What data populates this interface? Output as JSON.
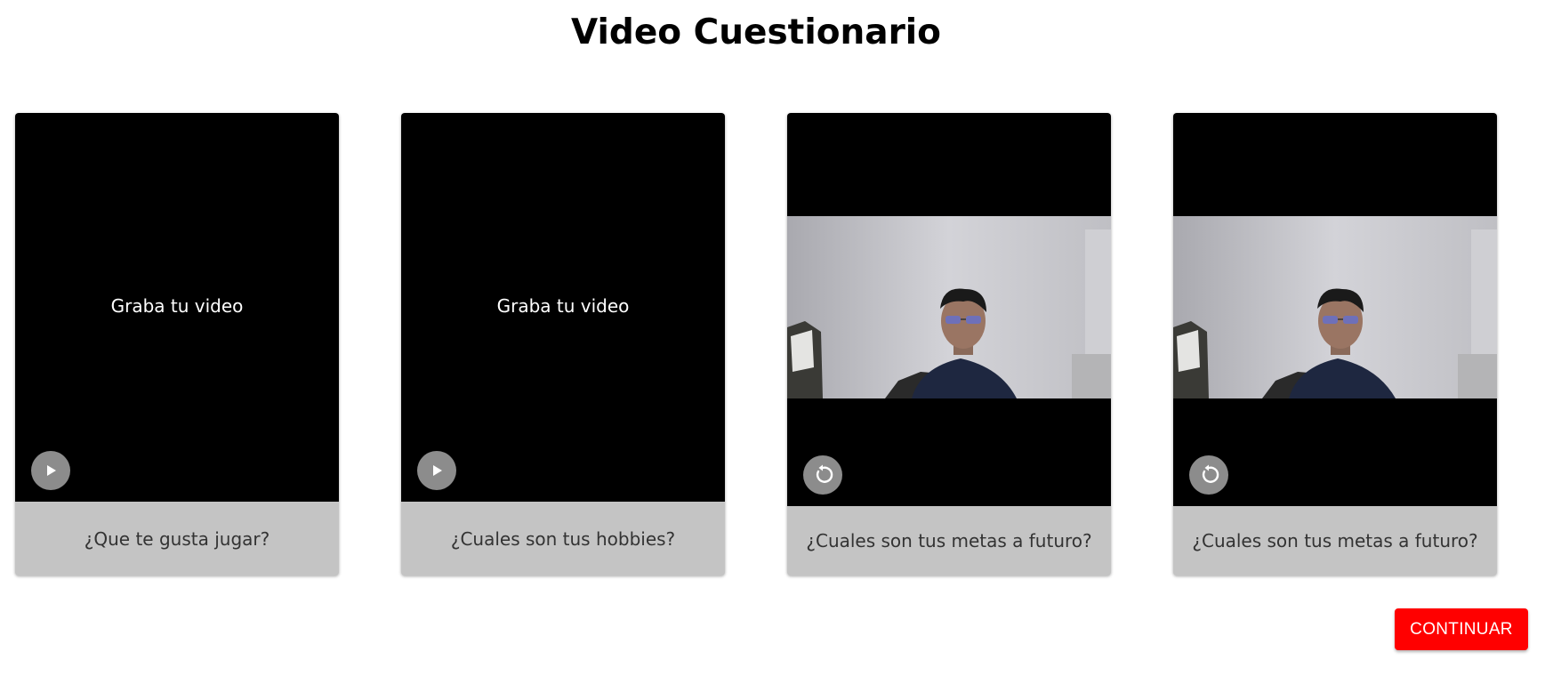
{
  "page": {
    "title": "Video Cuestionario"
  },
  "cards": [
    {
      "state": "empty",
      "prompt": "Graba tu video",
      "action_icon": "play-icon",
      "question": "¿Que te gusta jugar?"
    },
    {
      "state": "empty",
      "prompt": "Graba tu video",
      "action_icon": "play-icon",
      "question": "¿Cuales son tus hobbies?"
    },
    {
      "state": "recorded",
      "action_icon": "replay-icon",
      "question": "¿Cuales son tus metas a futuro?"
    },
    {
      "state": "recorded",
      "action_icon": "replay-icon",
      "question": "¿Cuales son tus metas a futuro?"
    }
  ],
  "actions": {
    "continue_label": "CONTINUAR"
  },
  "colors": {
    "continue_button": "#ff0000",
    "video_background": "#000000",
    "question_bar": "#c4c4c4",
    "control_button": "#8c8c8c"
  }
}
